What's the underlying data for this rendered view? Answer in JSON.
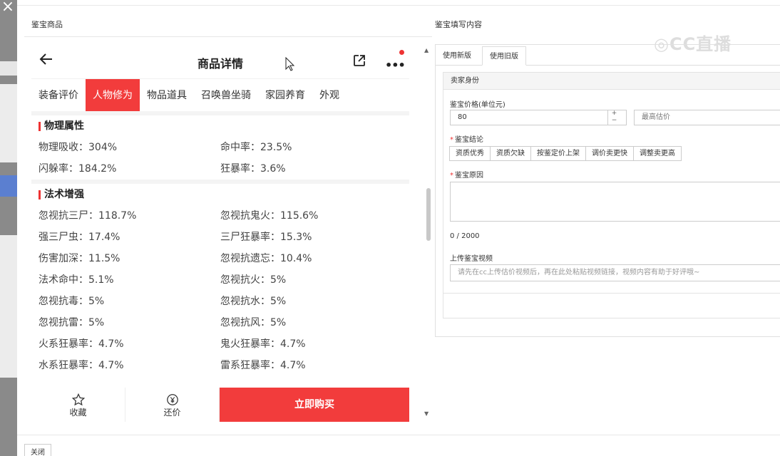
{
  "left_panel": {
    "title": "鉴宝商品"
  },
  "right_panel": {
    "title": "鉴宝填写内容"
  },
  "phone": {
    "header_title": "商品详情",
    "tabs": [
      "装备评价",
      "人物修为",
      "物品道具",
      "召唤兽坐骑",
      "家园养育",
      "外观"
    ],
    "active_tab": "人物修为",
    "sections": [
      {
        "title": "物理属性",
        "rows": [
          [
            "物理吸收：304%",
            "命中率：23.5%"
          ],
          [
            "闪躲率：184.2%",
            "狂暴率：3.6%"
          ]
        ]
      },
      {
        "title": "法术增强",
        "rows": [
          [
            "忽视抗三尸：118.7%",
            "忽视抗鬼火：115.6%"
          ],
          [
            "强三尸虫：17.4%",
            "三尸狂暴率：15.3%"
          ],
          [
            "伤害加深：11.5%",
            "忽视抗遗忘：10.4%"
          ],
          [
            "法术命中：5.1%",
            "忽视抗火：5%"
          ],
          [
            "忽视抗毒：5%",
            "忽视抗水：5%"
          ],
          [
            "忽视抗雷：5%",
            "忽视抗风：5%"
          ],
          [
            "火系狂暴率：4.7%",
            "鬼火狂暴率：4.7%"
          ],
          [
            "水系狂暴率：4.7%",
            "雷系狂暴率：4.7%"
          ]
        ]
      }
    ],
    "bottom": {
      "favorite": "收藏",
      "counter_offer": "还价",
      "buy": "立即购买"
    }
  },
  "form": {
    "tabs": [
      "使用新版",
      "使用旧版"
    ],
    "active_tab": "使用旧版",
    "section_title": "卖家身份",
    "price_label": "鉴宝价格(单位元)",
    "price_value": "80",
    "max_price_placeholder": "最高估价",
    "conclusion_label": "鉴宝结论",
    "conclusion_options": [
      "资质优秀",
      "资质欠缺",
      "按鉴定价上架",
      "调价卖更快",
      "调整卖更高"
    ],
    "reason_label": "鉴宝原因",
    "char_count": "0 / 2000",
    "video_label": "上传鉴宝视频",
    "video_placeholder": "请先在cc上传估价视频后，再在此处粘贴视频链接，视频内容有助于好评哦~"
  },
  "watermark": "CC直播",
  "footer": {
    "close": "关闭"
  },
  "colors": {
    "accent": "#f23c3c"
  }
}
